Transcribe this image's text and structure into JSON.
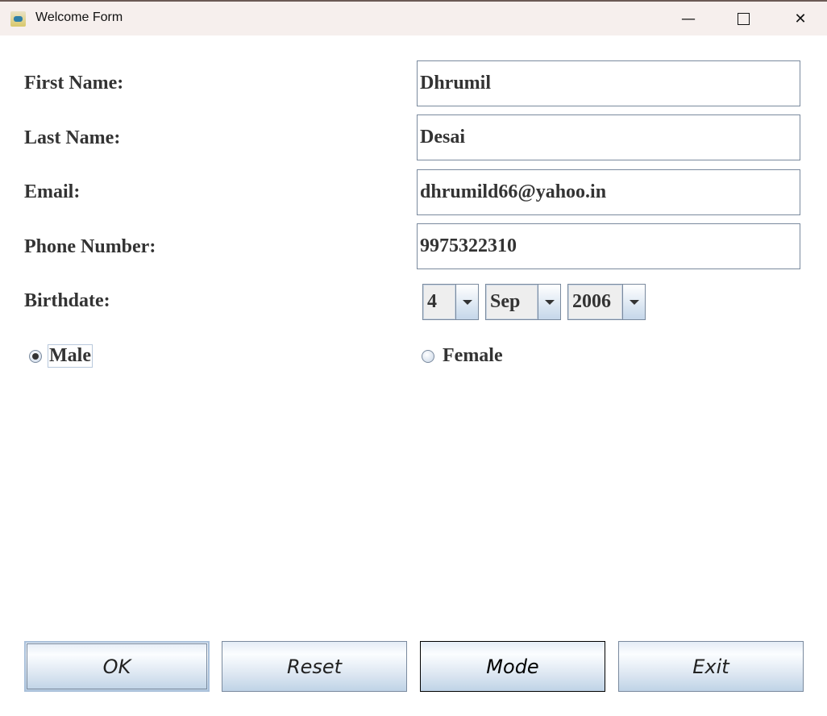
{
  "window": {
    "title": "Welcome Form"
  },
  "form": {
    "first_name_label": "First Name:",
    "first_name": "Dhrumil",
    "last_name_label": "Last Name:",
    "last_name": "Desai",
    "email_label": "Email:",
    "email": "dhrumild66@yahoo.in",
    "phone_label": "Phone Number:",
    "phone": "9975322310",
    "birthdate_label": "Birthdate:",
    "day": "4",
    "month": "Sep",
    "year": "2006",
    "gender_male": "Male",
    "gender_female": "Female",
    "selected_gender": "Male"
  },
  "buttons": {
    "ok": "OK",
    "reset": "Reset",
    "mode": "Mode",
    "exit": "Exit"
  }
}
